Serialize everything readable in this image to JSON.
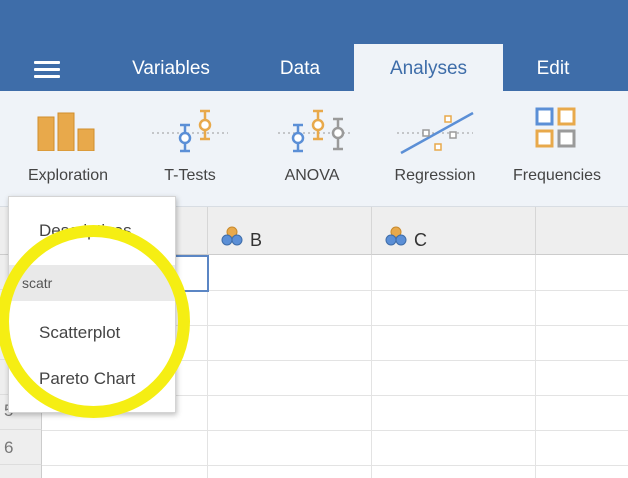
{
  "header": {
    "tabs": [
      {
        "label": "Variables"
      },
      {
        "label": "Data"
      },
      {
        "label": "Analyses",
        "active": true
      },
      {
        "label": "Edit"
      }
    ]
  },
  "ribbon": {
    "tools": [
      {
        "label": "Exploration",
        "icon": "exploration-bar-icon"
      },
      {
        "label": "T-Tests",
        "icon": "t-tests-icon"
      },
      {
        "label": "ANOVA",
        "icon": "anova-icon"
      },
      {
        "label": "Regression",
        "icon": "regression-icon"
      },
      {
        "label": "Frequencies",
        "icon": "frequencies-icon"
      }
    ]
  },
  "spreadsheet": {
    "columns": [
      {
        "name": "B",
        "icon": "nominal-variable-icon"
      },
      {
        "name": "C",
        "icon": "nominal-variable-icon"
      }
    ],
    "visible_row_numbers": [
      "5",
      "6"
    ]
  },
  "menu": {
    "search_value": "scatr",
    "items": [
      "Descriptives",
      "Scatterplot",
      "Pareto Chart"
    ]
  },
  "colors": {
    "header_blue": "#3e6da9",
    "ribbon_bg": "#eff3f8",
    "icon_orange": "#e8a94b",
    "icon_blue": "#5b8fd6",
    "icon_gray": "#9a9a9a",
    "annotation_yellow": "#f5ee13"
  }
}
